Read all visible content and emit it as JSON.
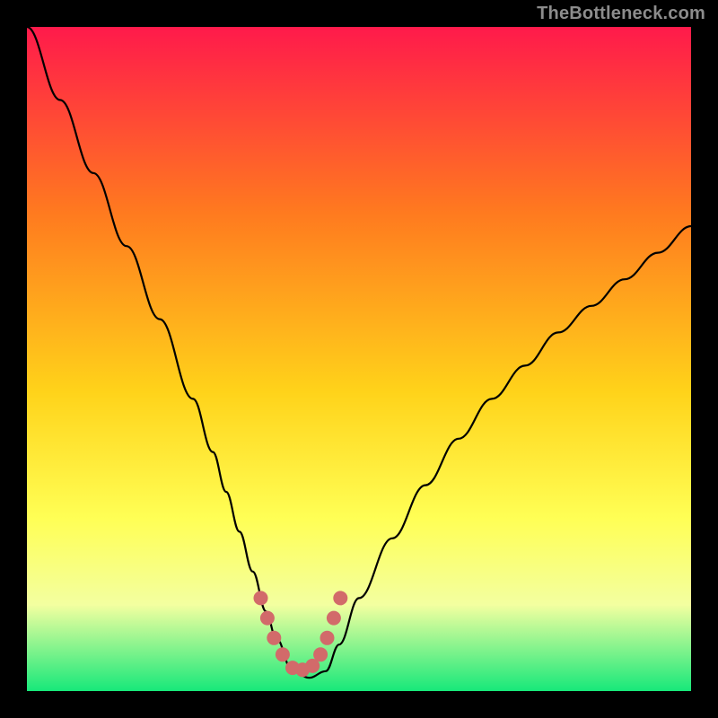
{
  "watermark": "TheBottleneck.com",
  "colors": {
    "background": "#000000",
    "gradient_top": "#ff1a4b",
    "gradient_mid1": "#ff7a1f",
    "gradient_mid2": "#ffd31a",
    "gradient_mid3": "#ffff55",
    "gradient_mid4": "#f3ffa0",
    "gradient_bottom": "#17e87a",
    "curve": "#000000",
    "marker": "#d26a6a"
  },
  "chart_data": {
    "type": "line",
    "title": "",
    "xlabel": "",
    "ylabel": "",
    "xlim": [
      0,
      100
    ],
    "ylim": [
      0,
      100
    ],
    "series": [
      {
        "name": "bottleneck-curve",
        "x": [
          0,
          5,
          10,
          15,
          20,
          25,
          28,
          30,
          32,
          34,
          36,
          37.5,
          40,
          42.5,
          45,
          47,
          50,
          55,
          60,
          65,
          70,
          75,
          80,
          85,
          90,
          95,
          100
        ],
        "y": [
          100,
          89,
          78,
          67,
          56,
          44,
          36,
          30,
          24,
          18,
          12,
          8,
          3,
          2,
          3,
          7,
          14,
          23,
          31,
          38,
          44,
          49,
          54,
          58,
          62,
          66,
          70
        ]
      }
    ],
    "marker_region": {
      "name": "optimal-zone",
      "x": [
        35.2,
        36.2,
        37.2,
        38.5,
        40,
        41.5,
        43,
        44.2,
        45.2,
        46.2,
        47.2
      ],
      "y": [
        14,
        11,
        8,
        5.5,
        3.5,
        3.2,
        3.8,
        5.5,
        8,
        11,
        14
      ]
    }
  }
}
